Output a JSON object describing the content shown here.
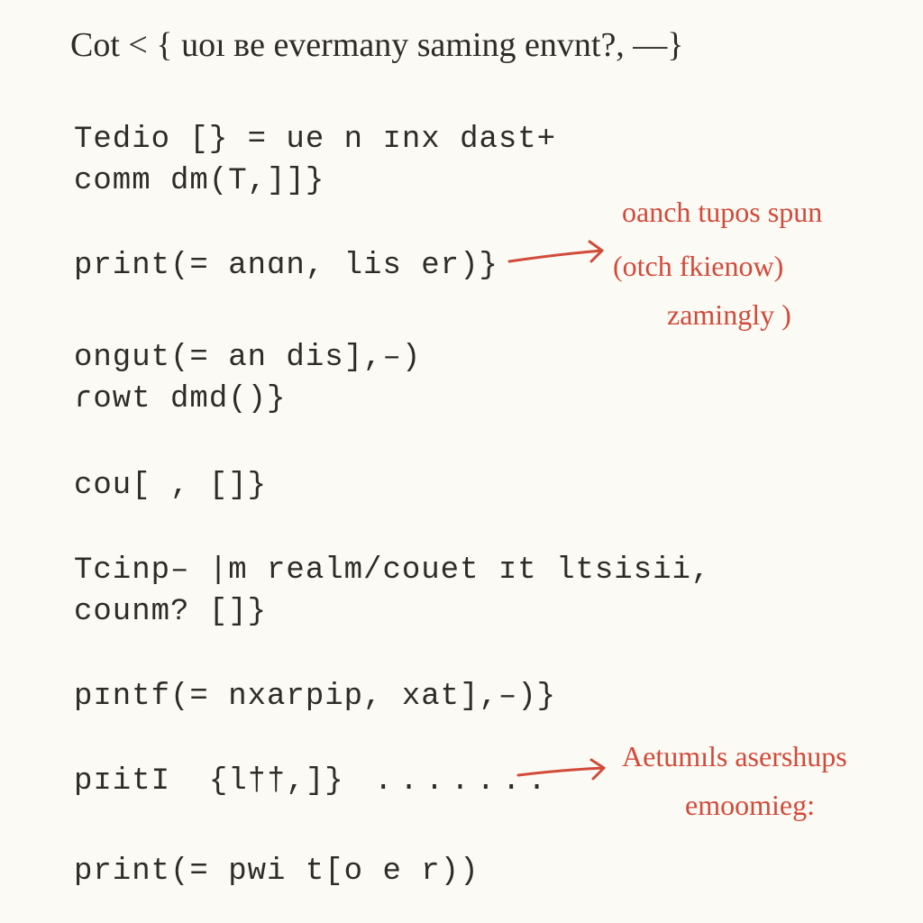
{
  "header": "Cot < { uoı ʙe evermany saming envnt?, —}",
  "code": {
    "l1": "Tedio [} = ue n ɪnx dast+",
    "l2": "comm dm(T,]]}",
    "l3": "print(= anɑn, lis er)}",
    "l4": "ongut(= an dis],–)",
    "l5": "ɾowt dmd()}",
    "l6": "cou[ , []}",
    "l7": "Tcinp– |m realm/couet ɪt ltsisii,",
    "l8": "counm? []}",
    "l9": "pɪntf(= nxarpip, xat],–)}",
    "l10": "pɪitI  {l††,]} ",
    "l11": "print(= pwi t[o e r))"
  },
  "dots": ".......",
  "annotations": {
    "a1_l1": "oanch tupos spun",
    "a1_l2": "(otch fkienow)",
    "a1_l3": "zamingly )",
    "a2_l1": "Aetumıls asershups",
    "a2_l2": "emoomieg:"
  }
}
